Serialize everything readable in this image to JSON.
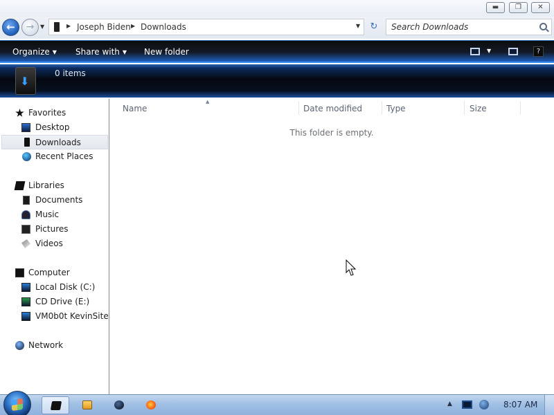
{
  "window": {
    "minimize_glyph": "▬",
    "maximize_glyph": "❐",
    "close_glyph": "✕"
  },
  "address": {
    "back_glyph": "←",
    "forward_glyph": "→",
    "history_glyph": "▼",
    "sep_glyph": "▶",
    "crumbs": [
      "Joseph Biden",
      "Downloads"
    ],
    "drop_glyph": "▼",
    "refresh_glyph": "↻"
  },
  "search": {
    "placeholder": "Search Downloads"
  },
  "toolbar": {
    "organize_label": "Organize",
    "share_label": "Share with",
    "new_folder_label": "New folder",
    "dropdown_glyph": "▼",
    "help_glyph": "?"
  },
  "details": {
    "item_count": "0 items"
  },
  "sidebar": {
    "favorites_label": "Favorites",
    "favorites": [
      "Desktop",
      "Downloads",
      "Recent Places"
    ],
    "libraries_label": "Libraries",
    "libraries": [
      "Documents",
      "Music",
      "Pictures",
      "Videos"
    ],
    "computer_label": "Computer",
    "drives": [
      "Local Disk (C:)",
      "CD Drive (E:)",
      "VM0b0t KevinSite"
    ],
    "network_label": "Network",
    "selected": "Downloads"
  },
  "content": {
    "columns": [
      "Name",
      "Date modified",
      "Type",
      "Size"
    ],
    "sort_glyph": "▲",
    "empty_message": "This folder is empty."
  },
  "taskbar": {
    "tray_arrow_glyph": "▲",
    "clock": "8:07 AM"
  },
  "colors": {
    "toolbar_accent": "#1e5fbe",
    "selection_bg": "#e4e8ee",
    "taskbar": "#9ebee3"
  }
}
